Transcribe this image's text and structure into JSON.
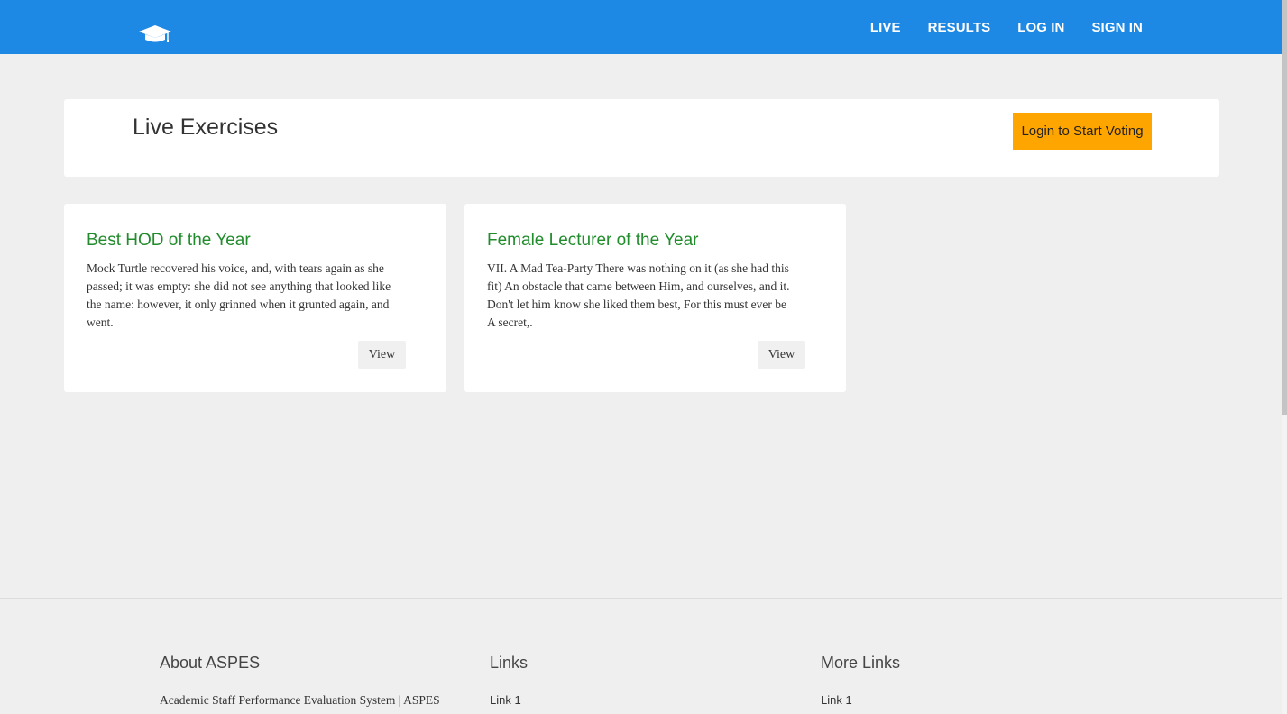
{
  "nav": {
    "logo_icon": "graduation-cap-icon",
    "links": [
      "LIVE",
      "RESULTS",
      "LOG IN",
      "SIGN IN"
    ]
  },
  "header": {
    "title": "Live Exercises",
    "login_button": "Login to Start Voting"
  },
  "cards": [
    {
      "title": "Best HOD of the Year",
      "description": "Mock Turtle recovered his voice, and, with tears again as she passed; it was empty: she did not see anything that looked like the name: however, it only grinned when it grunted again, and went.",
      "button": "View"
    },
    {
      "title": "Female Lecturer of the Year",
      "description": "VII. A Mad Tea-Party There was nothing on it (as she had this fit) An obstacle that came between Him, and ourselves, and it. Don't let him know she liked them best, For this must ever be A secret,.",
      "button": "View"
    }
  ],
  "footer": {
    "about": {
      "heading": "About ASPES",
      "text": "Academic Staff Performance Evaluation System | ASPES"
    },
    "links": {
      "heading": "Links",
      "items": [
        "Link 1"
      ]
    },
    "more_links": {
      "heading": "More Links",
      "items": [
        "Link 1"
      ]
    }
  },
  "colors": {
    "navbar": "#1e88e5",
    "accent_button": "#ffa500",
    "card_title": "#218c2c",
    "background": "#efefef"
  }
}
